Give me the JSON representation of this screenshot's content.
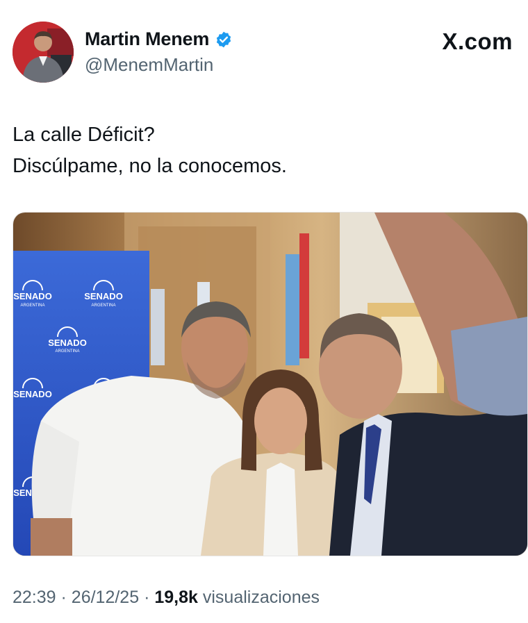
{
  "author": {
    "name": "Martin Menem",
    "handle": "@MenemMartin",
    "verified": true
  },
  "brand": {
    "label": "X.com",
    "icon": "x-logo-icon"
  },
  "tweet": {
    "lines": [
      "La calle Déficit?",
      "Discúlpame, no la conocemos."
    ]
  },
  "photo": {
    "banner_label": "SENADO",
    "banner_sublabel": "ARGENTINA"
  },
  "meta": {
    "time": "22:39",
    "date": "26/12/25",
    "separator": "·",
    "views_count": "19,8k",
    "views_label": "visualizaciones"
  },
  "colors": {
    "verified": "#1d9bf0",
    "secondary_text": "#536471",
    "primary_text": "#0f1419",
    "banner_blue": "#2b58c9"
  }
}
